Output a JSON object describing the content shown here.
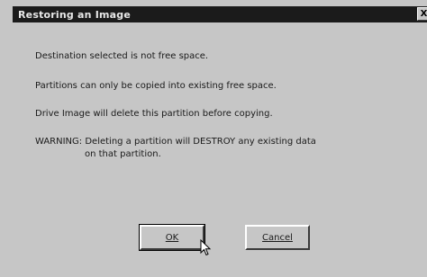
{
  "dialog": {
    "title": "Restoring an Image",
    "close_glyph": "X",
    "messages": [
      "Destination selected is not free space.",
      "Partitions can only be copied into existing free space.",
      "Drive Image will delete this partition before copying."
    ],
    "warning": {
      "line1": "WARNING: Deleting a partition will DESTROY any existing data",
      "line2": "on that partition."
    },
    "buttons": {
      "ok": "OK",
      "cancel": "Cancel"
    },
    "colors": {
      "title_bar": "#1b1b1b",
      "face": "#c6c6c6"
    }
  }
}
